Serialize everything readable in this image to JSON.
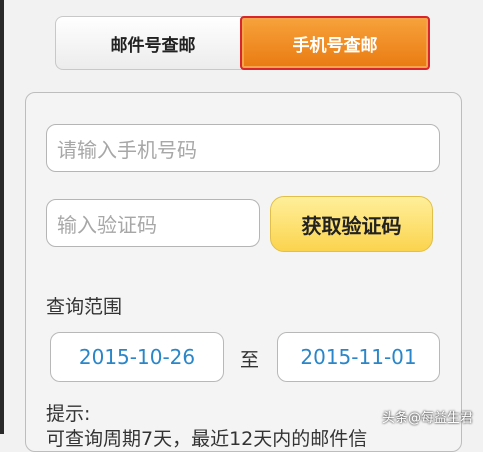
{
  "tabs": {
    "mail": "邮件号查邮",
    "phone": "手机号查邮"
  },
  "form": {
    "phone_placeholder": "请输入手机号码",
    "code_placeholder": "输入验证码",
    "get_code_button": "获取验证码"
  },
  "range": {
    "label": "查询范围",
    "from": "2015-10-26",
    "separator": "至",
    "to": "2015-11-01"
  },
  "hint": {
    "label": "提示:",
    "text": "可查询周期7天，最近12天内的邮件信"
  },
  "watermark": "头条@每益生君",
  "colors": {
    "accent_orange": "#ea7a12",
    "selected_border": "#d9262a",
    "button_yellow": "#fbd44e",
    "date_text": "#2a86c8"
  }
}
